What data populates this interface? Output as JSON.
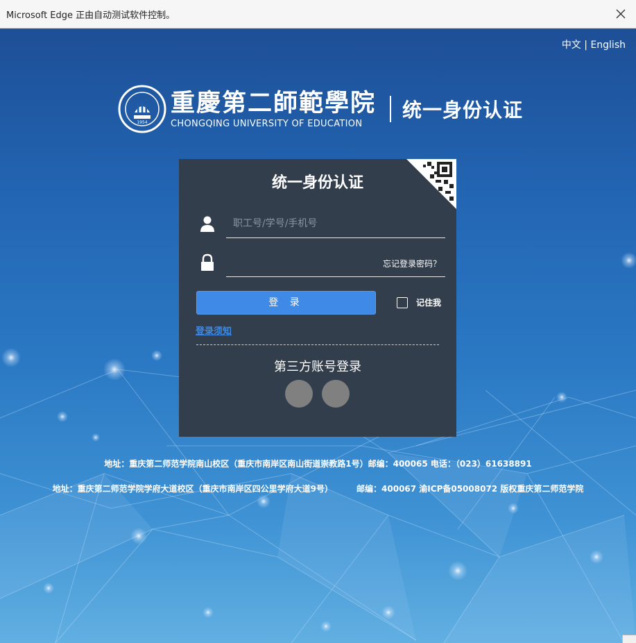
{
  "browser": {
    "notice": "Microsoft Edge 正由自动测试软件控制。"
  },
  "lang": {
    "zh": "中文",
    "separator": "|",
    "en": "English"
  },
  "brand": {
    "name_cn": "重慶第二師範學院",
    "name_en": "CHONGQING UNIVERSITY OF EDUCATION",
    "system": "统一身份认证",
    "seal_year": "1954"
  },
  "login": {
    "title": "统一身份认证",
    "username_placeholder": "职工号/学号/手机号",
    "username_value": "",
    "password_value": "",
    "forgot": "忘记登录密码？",
    "submit": "登 录",
    "remember": "记住我",
    "notice_link": "登录须知",
    "third_party": "第三方账号登录"
  },
  "footer": {
    "line1": "地址：重庆第二师范学院南山校区（重庆市南岸区南山街道崇教路1号）邮编：400065 电话：（023）61638891",
    "line2a": "地址：重庆第二师范学院学府大道校区（重庆市南岸区四公里学府大道9号）",
    "line2b": "邮编：400067 渝ICP备05008072 版权重庆第二师范学院"
  },
  "colors": {
    "panel": "#333e4d",
    "button": "#3e8ae6",
    "link": "#3d8ae6"
  },
  "icons": [
    "close-icon",
    "user-icon",
    "lock-icon",
    "qr-code-icon",
    "university-seal-icon"
  ]
}
